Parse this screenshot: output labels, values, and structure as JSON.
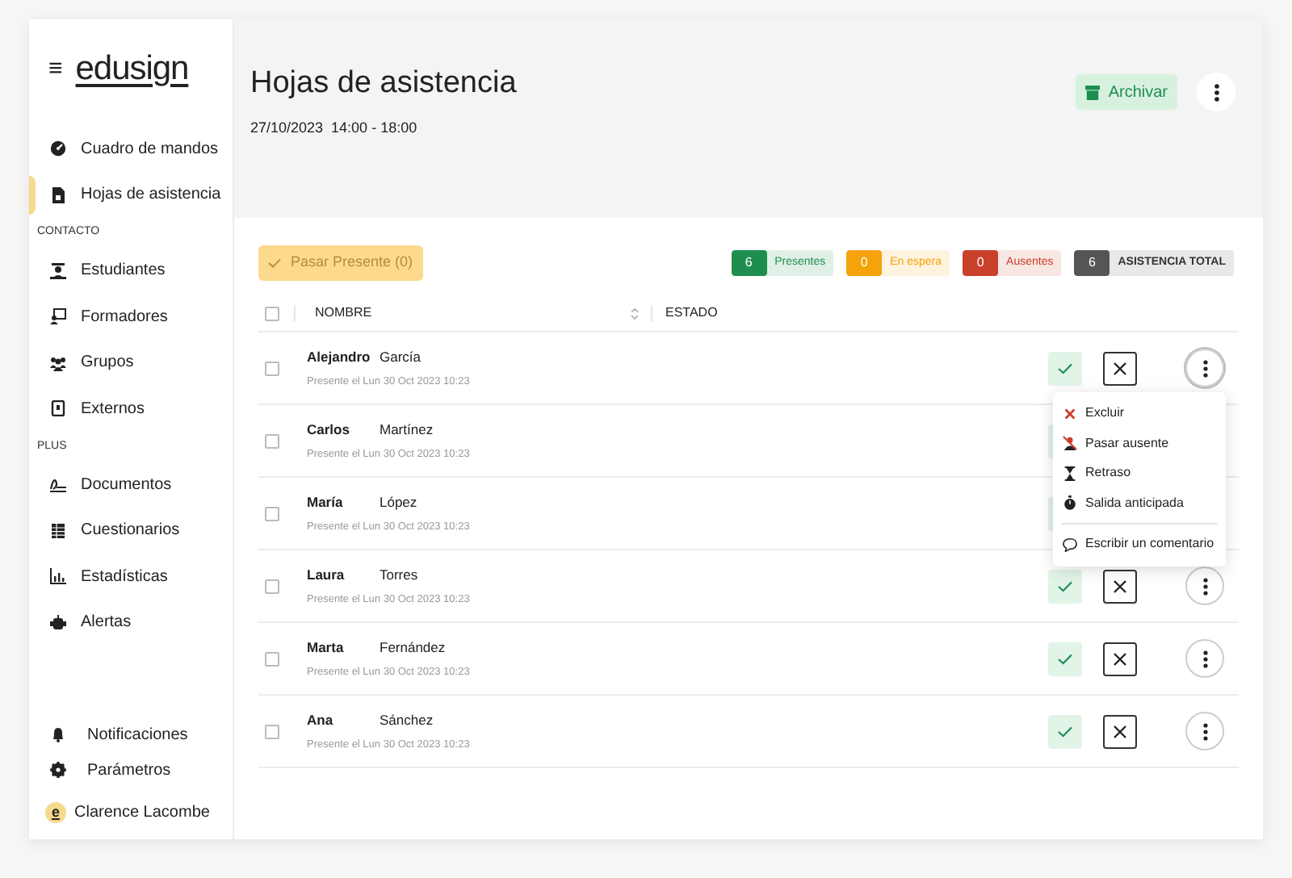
{
  "sidebar": {
    "logo": "edusign",
    "menu_icon": "≡",
    "sections": [
      {
        "items": [
          {
            "label": "Cuadro de mandos",
            "selected": false
          },
          {
            "label": "Hojas de asistencia",
            "selected": true
          }
        ]
      },
      {
        "heading": "CONTACTO",
        "items": [
          {
            "label": "Estudiantes",
            "selected": false
          },
          {
            "label": "Formadores",
            "selected": false
          },
          {
            "label": "Grupos",
            "selected": false
          },
          {
            "label": "Externos",
            "selected": false
          }
        ]
      },
      {
        "heading": "PLUS",
        "items": [
          {
            "label": "Documentos",
            "selected": false
          },
          {
            "label": "Cuestionarios",
            "selected": false
          },
          {
            "label": "Estadísticas",
            "selected": false
          },
          {
            "label": "Alertas",
            "selected": false
          }
        ]
      }
    ],
    "footer": [
      {
        "label": "Notificaciones"
      },
      {
        "label": "Parámetros"
      }
    ],
    "user": {
      "initial": "e",
      "name": "Clarence Lacombe"
    }
  },
  "header": {
    "title": "Hojas de asistencia",
    "date": "27/10/2023  14:00 - 18:00",
    "archive_button": "Archivar"
  },
  "toolbar": {
    "present_button": "Pasar Presente (0)",
    "stats": [
      {
        "count": "6",
        "label": "Presentes",
        "color": "#1e8e4e"
      },
      {
        "count": "0",
        "label": "En espera",
        "color": "#f5a20b"
      },
      {
        "count": "0",
        "label": "Ausentes",
        "color": "#c9402b"
      },
      {
        "count": "6",
        "label": "ASISTENCIA TOTAL",
        "color": "#555555"
      }
    ]
  },
  "table": {
    "columns": [
      "NOMBRE",
      "ESTADO"
    ],
    "all_checked": false,
    "rows": [
      {
        "first": "Alejandro",
        "last": "García",
        "note": "Presente el Lun 30 Oct 2023 10:23",
        "checked": false,
        "menu_open": true
      },
      {
        "first": "Carlos",
        "last": "Martínez",
        "note": "Presente el Lun 30 Oct 2023 10:23",
        "checked": false,
        "menu_open": false
      },
      {
        "first": "María",
        "last": "López",
        "note": "Presente el Lun 30 Oct 2023 10:23",
        "checked": false,
        "menu_open": false
      },
      {
        "first": "Laura",
        "last": "Torres",
        "note": "Presente el Lun 30 Oct 2023 10:23",
        "checked": false,
        "menu_open": false
      },
      {
        "first": "Marta",
        "last": "Fernández",
        "note": "Presente el Lun 30 Oct 2023 10:23",
        "checked": false,
        "menu_open": false
      },
      {
        "first": "Ana",
        "last": "Sánchez",
        "note": "Presente el Lun 30 Oct 2023 10:23",
        "checked": false,
        "menu_open": false
      }
    ]
  },
  "row_menu": {
    "items": [
      {
        "label": "Excluir"
      },
      {
        "label": "Pasar ausente"
      },
      {
        "label": "Retraso"
      },
      {
        "label": "Salida anticipada"
      },
      {
        "label": "Escribir un comentario"
      }
    ]
  }
}
